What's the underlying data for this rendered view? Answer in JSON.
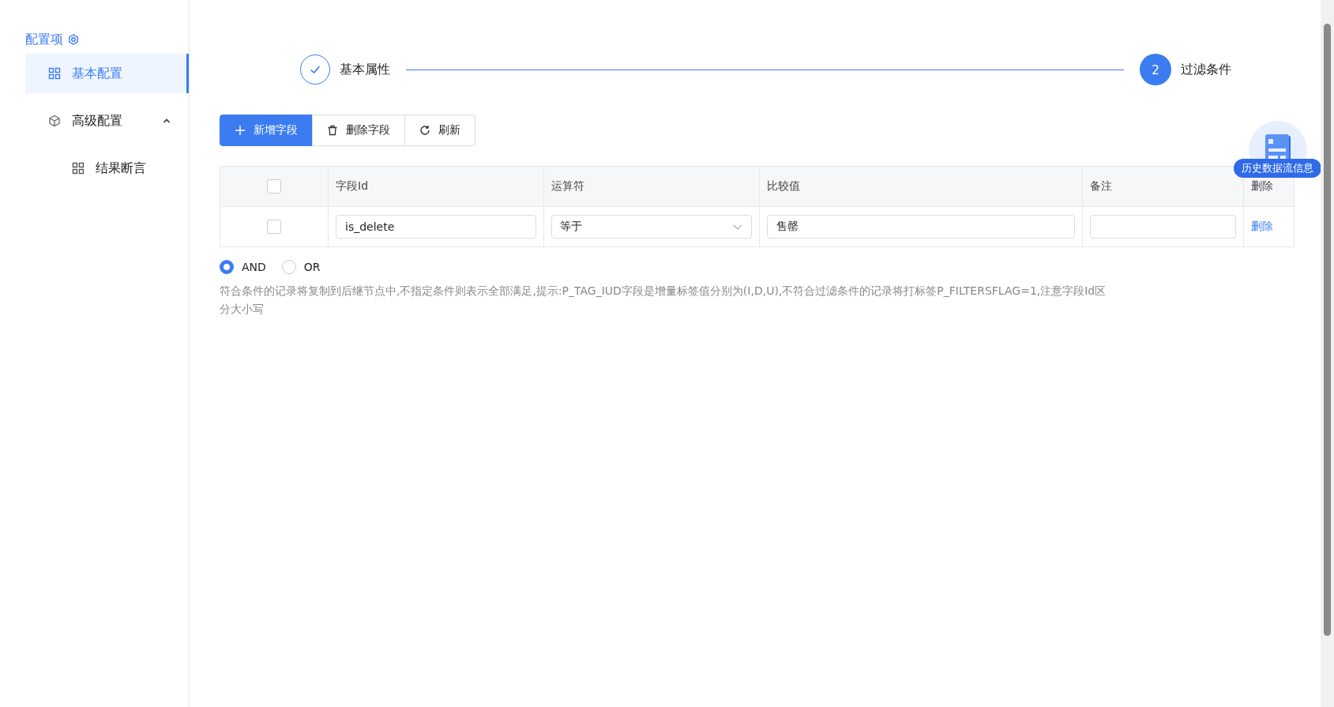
{
  "sidebar": {
    "title": "配置项",
    "items": [
      {
        "label": "基本配置",
        "kind": "grid",
        "selected": true
      },
      {
        "label": "高级配置",
        "kind": "cube",
        "selected": false,
        "expanded": true,
        "children": [
          {
            "label": "结果断言",
            "kind": "grid",
            "selected": false
          }
        ]
      }
    ]
  },
  "steps": [
    {
      "label": "基本属性",
      "completed": true
    },
    {
      "label": "过滤条件",
      "number": "2",
      "completed": false
    }
  ],
  "toolbar": [
    {
      "label": "新增字段",
      "kind": "add"
    },
    {
      "label": "删除字段",
      "kind": "delete"
    },
    {
      "label": "刷新",
      "kind": "refresh"
    }
  ],
  "table": {
    "columns": [
      "字段Id",
      "运算符",
      "比较值",
      "备注",
      "删除"
    ],
    "header_checked": false,
    "rows": [
      {
        "checked": false,
        "field_id": "is_delete",
        "operator": "等于",
        "value": "售罄",
        "action": "删除"
      }
    ]
  },
  "logic": [
    {
      "label": "AND",
      "selected": true
    },
    {
      "label": "OR",
      "selected": false
    }
  ],
  "hint": "符合条件的记录将复制到后继节点中,不指定条件则表示全部满足,提示:P_TAG_IUD字段是增量标签值分别为(I,D,U),不符合过滤条件的记录将打标签P_FILTERSFLAG=1,注意字段Id区分大小写",
  "floating_badge": {
    "label": "历史数据流信息"
  }
}
